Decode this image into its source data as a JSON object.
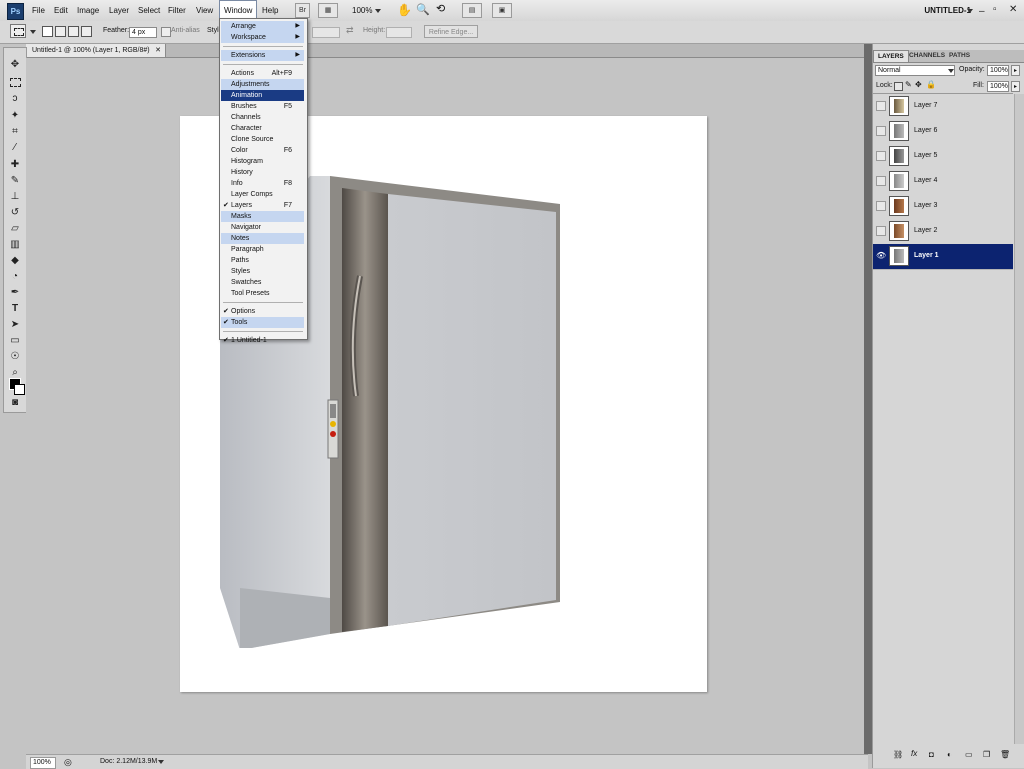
{
  "app": {
    "logo": "Ps",
    "doc_title": "UNTITLED-1"
  },
  "menu": {
    "items": [
      "File",
      "Edit",
      "Image",
      "Layer",
      "Select",
      "Filter",
      "View",
      "Window",
      "Help"
    ],
    "bridge_label": "Br",
    "zoom": "100%"
  },
  "options": {
    "feather_label": "Feather:",
    "feather_value": "4 px",
    "anti_alias_label": "Anti-alias",
    "style_label": "Style",
    "height_label": "Height:",
    "refine_edge_label": "Refine Edge..."
  },
  "document_tab": {
    "title": "Untitled-1 @ 100% (Layer 1, RGB/8#)"
  },
  "status": {
    "zoom": "100%",
    "doc_size": "Doc: 2.12M/13.9M"
  },
  "window_menu": [
    {
      "label": "Arrange",
      "submenu": true,
      "highlight": true
    },
    {
      "label": "Workspace",
      "submenu": true,
      "highlight": true
    },
    {
      "sep": true
    },
    {
      "label": "Extensions",
      "submenu": true,
      "highlight": true
    },
    {
      "sep": true
    },
    {
      "label": "Actions",
      "shortcut": "Alt+F9"
    },
    {
      "label": "Adjustments",
      "highlight": true
    },
    {
      "label": "Animation",
      "selected": true
    },
    {
      "label": "Brushes",
      "shortcut": "F5"
    },
    {
      "label": "Channels"
    },
    {
      "label": "Character"
    },
    {
      "label": "Clone Source"
    },
    {
      "label": "Color",
      "shortcut": "F6"
    },
    {
      "label": "Histogram"
    },
    {
      "label": "History"
    },
    {
      "label": "Info",
      "shortcut": "F8"
    },
    {
      "label": "Layer Comps"
    },
    {
      "label": "Layers",
      "shortcut": "F7",
      "checked": true
    },
    {
      "label": "Masks",
      "highlight": true
    },
    {
      "label": "Navigator"
    },
    {
      "label": "Notes",
      "highlight": true
    },
    {
      "label": "Paragraph"
    },
    {
      "label": "Paths"
    },
    {
      "label": "Styles"
    },
    {
      "label": "Swatches"
    },
    {
      "label": "Tool Presets"
    },
    {
      "sep": true
    },
    {
      "label": "Options",
      "checked": true
    },
    {
      "label": "Tools",
      "checked": true,
      "highlight": true
    },
    {
      "sep": true
    },
    {
      "label": "1 Untitled-1",
      "checked": true
    }
  ],
  "panel": {
    "tabs": [
      "LAYERS",
      "CHANNELS",
      "PATHS"
    ],
    "blend_mode": "Normal",
    "opacity_label": "Opacity:",
    "opacity_value": "100%",
    "lock_label": "Lock:",
    "fill_label": "Fill:",
    "fill_value": "100%",
    "layers": [
      {
        "name": "Layer 7"
      },
      {
        "name": "Layer 6"
      },
      {
        "name": "Layer 5"
      },
      {
        "name": "Layer 4"
      },
      {
        "name": "Layer 3"
      },
      {
        "name": "Layer 2"
      },
      {
        "name": "Layer 1",
        "selected": true,
        "visible": true
      }
    ]
  },
  "colors": {
    "selection": "#0c2370",
    "menu_highlight": "#c5d6f0",
    "menu_selected": "#1a3b84"
  }
}
